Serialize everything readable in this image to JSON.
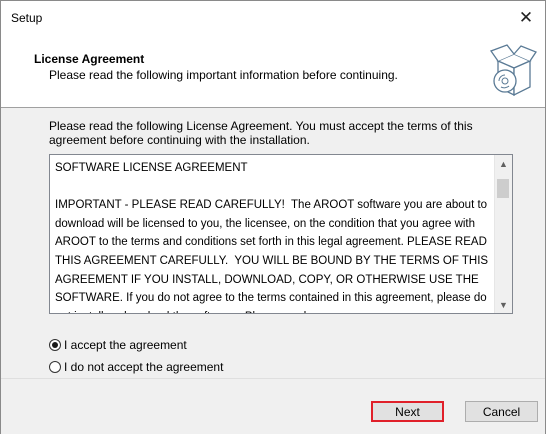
{
  "window": {
    "title": "Setup",
    "close_glyph": "✕"
  },
  "header": {
    "title": "License Agreement",
    "subtitle": "Please read the following important information before continuing.",
    "logo_icon": "software-box-cd-icon"
  },
  "intro": "Please read the following License Agreement. You must accept the terms of this agreement before continuing with the installation.",
  "license": {
    "text": "SOFTWARE LICENSE AGREEMENT\n\nIMPORTANT - PLEASE READ CAREFULLY!  The AROOT software you are about to download will be licensed to you, the licensee, on the condition that you agree with AROOT to the terms and conditions set forth in this legal agreement. PLEASE READ THIS AGREEMENT CAREFULLY.  YOU WILL BE BOUND BY THE TERMS OF THIS AGREEMENT IF YOU INSTALL, DOWNLOAD, COPY, OR OTHERWISE USE THE SOFTWARE. If you do not agree to the terms contained in this agreement, please do not install or download the software.  Please read"
  },
  "options": {
    "accept": {
      "label": "I accept the agreement",
      "selected": true
    },
    "decline": {
      "label": "I do not accept the agreement",
      "selected": false
    }
  },
  "buttons": {
    "next": "Next",
    "cancel": "Cancel"
  }
}
